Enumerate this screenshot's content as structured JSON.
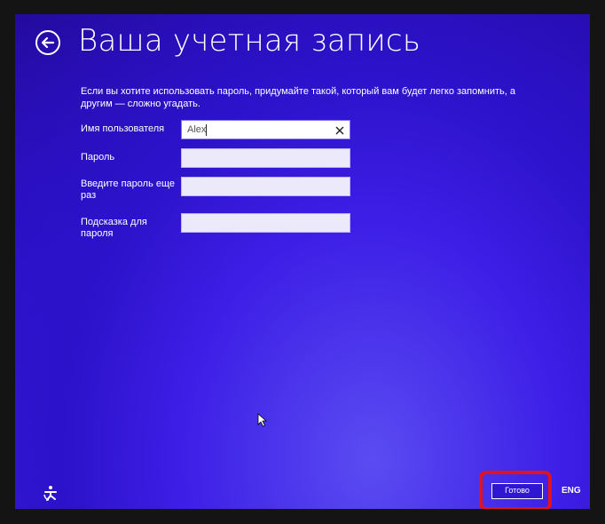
{
  "page": {
    "title": "Ваша учетная запись",
    "instruction": "Если вы хотите использовать пароль, придумайте такой, который вам будет легко запомнить, а другим — сложно угадать."
  },
  "form": {
    "username": {
      "label": "Имя пользователя",
      "value": "Alex"
    },
    "password": {
      "label": "Пароль",
      "value": ""
    },
    "password_confirm": {
      "label": "Введите пароль еще раз",
      "value": ""
    },
    "password_hint": {
      "label": "Подсказка для пароля",
      "value": ""
    }
  },
  "footer": {
    "done_label": "Готово",
    "language": "ENG"
  },
  "colors": {
    "background": "#2a10c2",
    "highlight": "#e3121b",
    "field_fill": "#ece9fb"
  },
  "icons": {
    "back": "back-arrow-icon",
    "clear": "close-icon",
    "ease_of_access": "ease-of-access-icon",
    "cursor": "mouse-pointer-icon"
  }
}
